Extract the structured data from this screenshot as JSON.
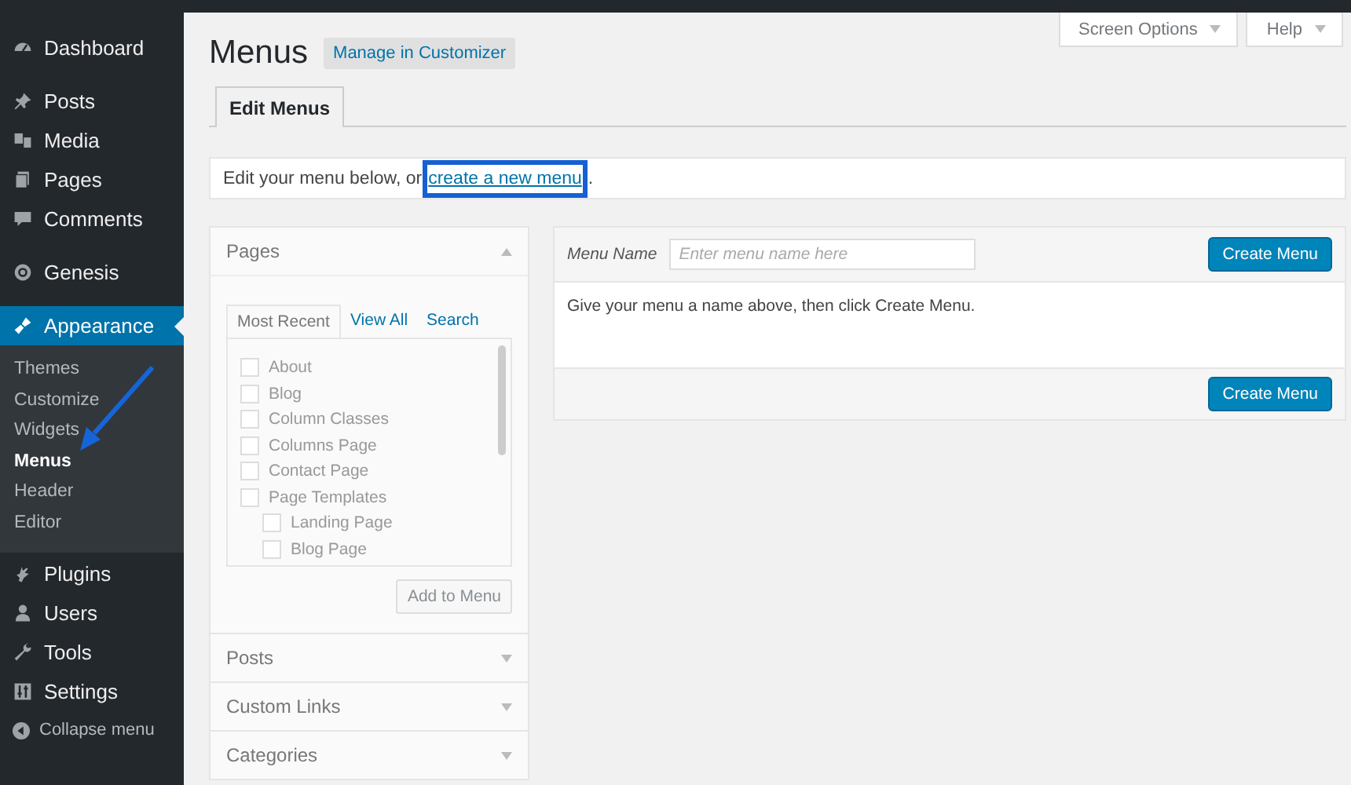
{
  "sidebar": {
    "annotation_arrow": true,
    "groups": [
      [
        {
          "label": "Dashboard",
          "selected": false
        }
      ],
      [
        {
          "label": "Posts",
          "selected": false
        },
        {
          "label": "Media",
          "selected": false
        },
        {
          "label": "Pages",
          "selected": false
        },
        {
          "label": "Comments",
          "selected": false
        }
      ],
      [
        {
          "label": "Genesis",
          "selected": false
        }
      ],
      [
        {
          "label": "Appearance",
          "selected": true,
          "children": [
            {
              "label": "Themes",
              "selected": false
            },
            {
              "label": "Customize",
              "selected": false
            },
            {
              "label": "Widgets",
              "selected": false
            },
            {
              "label": "Menus",
              "selected": true
            },
            {
              "label": "Header",
              "selected": false
            },
            {
              "label": "Editor",
              "selected": false
            }
          ]
        },
        {
          "label": "Plugins",
          "selected": false
        },
        {
          "label": "Users",
          "selected": false
        },
        {
          "label": "Tools",
          "selected": false
        },
        {
          "label": "Settings",
          "selected": false
        }
      ]
    ],
    "collapse": {
      "label": "Collapse menu"
    }
  },
  "header": {
    "title": "Menus",
    "action": "Manage in Customizer",
    "screen_buttons": [
      "Screen Options",
      "Help"
    ]
  },
  "tabs": [
    {
      "label": "Edit Menus",
      "selected": true
    }
  ],
  "notice": {
    "text": "Edit your menu below, or ",
    "link": "create a new menu",
    "link_highlighted": true,
    "after": "."
  },
  "accordion": [
    {
      "title": "Pages",
      "expanded": true,
      "tabs": [
        {
          "label": "Most Recent",
          "selected": true
        },
        {
          "label": "View All",
          "selected": false
        },
        {
          "label": "Search",
          "selected": false
        }
      ],
      "items": [
        {
          "label": "About",
          "checked": false
        },
        {
          "label": "Blog",
          "checked": false
        },
        {
          "label": "Column Classes",
          "checked": false
        },
        {
          "label": "Columns Page",
          "checked": false
        },
        {
          "label": "Contact Page",
          "checked": false
        },
        {
          "label": "Page Templates",
          "checked": false,
          "children": [
            {
              "label": "Landing Page",
              "checked": false
            },
            {
              "label": "Blog Page",
              "checked": false
            }
          ]
        }
      ],
      "button": {
        "label": "Add to Menu",
        "disabled": true
      }
    },
    {
      "title": "Posts",
      "expanded": false
    },
    {
      "title": "Custom Links",
      "expanded": false
    },
    {
      "title": "Categories",
      "expanded": false
    }
  ],
  "menu_editor": {
    "name_label": "Menu Name",
    "placeholder": "Enter menu name here",
    "button_top": "Create Menu",
    "message": "Give your menu a name above, then click Create Menu.",
    "button_bottom": "Create Menu"
  }
}
